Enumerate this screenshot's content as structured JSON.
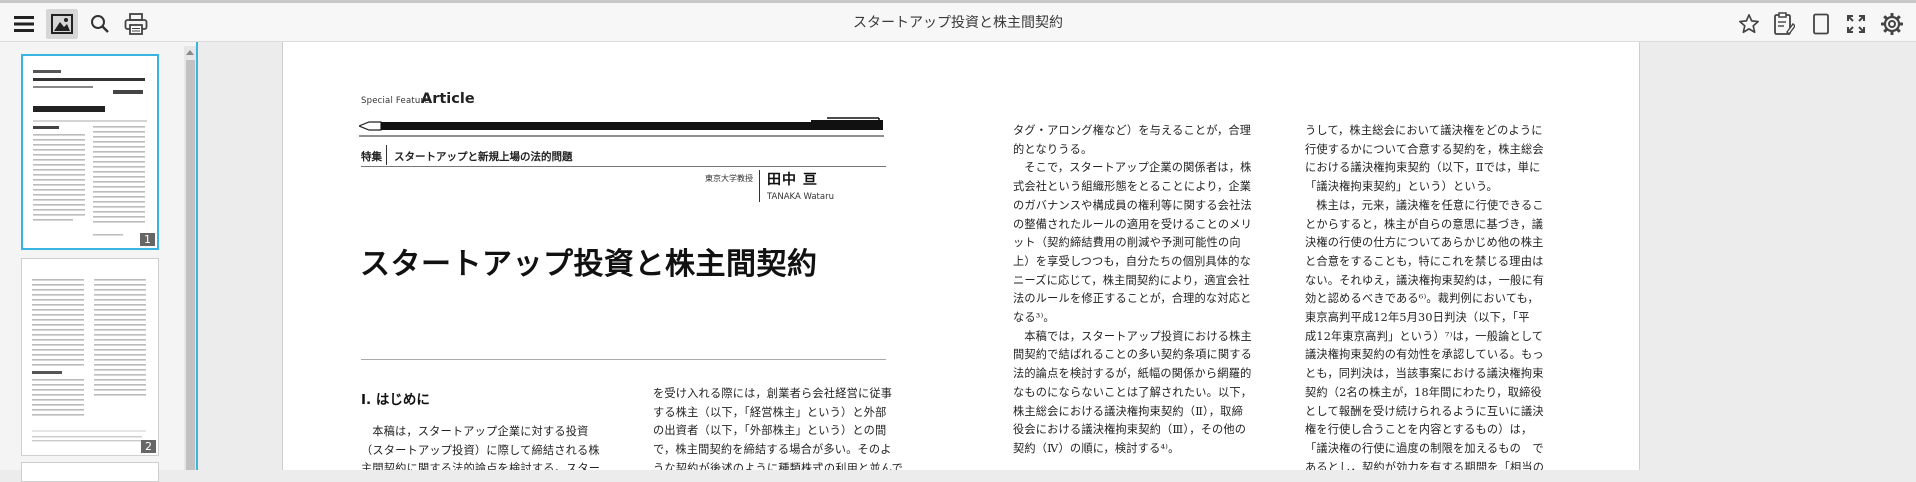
{
  "toolbar": {
    "title": "スタートアップ投資と株主間契約",
    "icons": [
      "menu-icon",
      "image-icon",
      "search-icon",
      "print-icon",
      "star-icon",
      "notes-icon",
      "page-view-icon",
      "fullscreen-icon",
      "gear-icon"
    ]
  },
  "sidebar": {
    "thumbnails": [
      {
        "page_number": "1",
        "selected": true
      },
      {
        "page_number": "2",
        "selected": false
      }
    ]
  },
  "article": {
    "special_feature": "Special Feature",
    "article_label": "Article",
    "feature_label": "特集",
    "feature_title": "スタートアップと新規上場の法的問題",
    "affiliation": "東京大学教授",
    "author_name": "田中 亘",
    "author_romaji": "TANAKA Wataru",
    "title": "スタートアップ投資と株主間契約",
    "section_heading": "Ⅰ. はじめに",
    "col1_lines": [
      "本稿は，スタートアップ企業に対する投資",
      "（スタートアップ投資）に際して締結される株",
      "主間契約に関する法的論点を検討する。スター"
    ],
    "col2_lines": [
      "を受け入れる際には，創業者ら会社経営に従事",
      "する株主（以下，「経営株主」という）と外部",
      "の出資者（以下，「外部株主」という）との間",
      "で，株主間契約を締結する場合が多い。そのよ",
      "うな契約が後述のように種類株式の利用と並んで"
    ],
    "col3_lines": [
      "タグ・アロング権など）を与えることが，合理",
      "的となりうる。",
      "そこで，スタートアップ企業の関係者は，株",
      "式会社という組織形態をとることにより，企業",
      "のガバナンスや構成員の権利等に関する会社法",
      "の整備されたルールの適用を受けることのメリ",
      "ット（契約締結費用の削減や予測可能性の向",
      "上）を享受しつつも，自分たちの個別具体的な",
      "ニーズに応じて，株主間契約により，適宜会社",
      "法のルールを修正することが，合理的な対応と",
      "なる³⁾。",
      "本稿では，スタートアップ投資における株主",
      "間契約で結ばれることの多い契約条項に関する",
      "法的論点を検討するが，紙幅の関係から網羅的",
      "なものにならないことは了解されたい。以下，",
      "株主総会における議決権拘束契約（Ⅱ），取締",
      "役会における議決権拘束契約（Ⅲ），その他の",
      "契約（Ⅳ）の順に，検討する⁴⁾。"
    ],
    "col4_lines": [
      "うして，株主総会において議決権をどのように",
      "行使するかについて合意する契約を，株主総会",
      "における議決権拘束契約（以下，Ⅱでは，単に",
      "「議決権拘束契約」という）という。",
      "株主は，元来，議決権を任意に行使できるこ",
      "とからすると，株主が自らの意思に基づき，議",
      "決権の行使の仕方についてあらかじめ他の株主",
      "と合意をすることも，特にこれを禁じる理由は",
      "ない。それゆえ，議決権拘束契約は，一般に有",
      "効と認めるべきである⁶⁾。裁判例においても，",
      "東京高判平成12年5月30日判決（以下，「平",
      "成12年東京高判」という）⁷⁾は，一般論として",
      "議決権拘束契約の有効性を承認している。もっ",
      "とも，同判決は，当該事案における議決権拘束",
      "契約（2名の株主が，18年間にわたり，取締役",
      "として報酬を受け続けられるように互いに議決",
      "権を行使し合うことを内容とするもの）は，",
      "「議決権の行使に過度の制限を加えるもの　で",
      "あるとし，契約が効力を有する期間を「相当の"
    ]
  }
}
